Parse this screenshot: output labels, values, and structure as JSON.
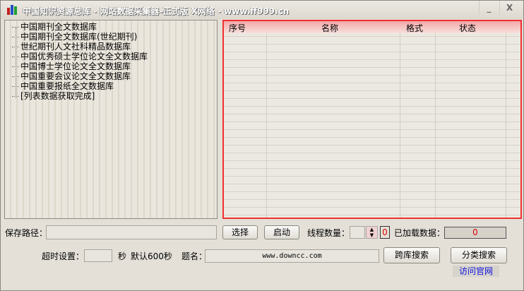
{
  "window": {
    "title": "中国知识资源总库 - 网站数据采集器-正式版 X网络 - www.ff999.cn",
    "minimize": "_",
    "close": "X"
  },
  "tree": {
    "items": [
      "中国期刊全文数据库",
      "中国期刊全文数据库(世纪期刊)",
      "世纪期刊人文社科精品数据库",
      "中国优秀硕士学位论文全文数据库",
      "中国博士学位论文全文数据库",
      "中国重要会议论文全文数据库",
      "中国重要报纸全文数据库",
      "[列表数据获取完成]"
    ]
  },
  "list": {
    "columns": [
      "序号",
      "名称",
      "格式",
      "状态"
    ]
  },
  "form": {
    "save_path_label": "保存路径：",
    "save_path_value": "",
    "select_button": "选择",
    "start_button": "启动",
    "thread_label": "线程数量：",
    "thread_value": "",
    "thread_count": "0",
    "loaded_label": "已加载数据：",
    "loaded_value": "0",
    "timeout_label": "超时设置：",
    "timeout_value": "",
    "timeout_unit": "秒",
    "timeout_default": "默认600秒",
    "title_label": "题名：",
    "title_value": "www.downcc.com",
    "cross_search_button": "跨库搜索",
    "category_search_button": "分类搜索",
    "visit_link": "访问官网"
  }
}
